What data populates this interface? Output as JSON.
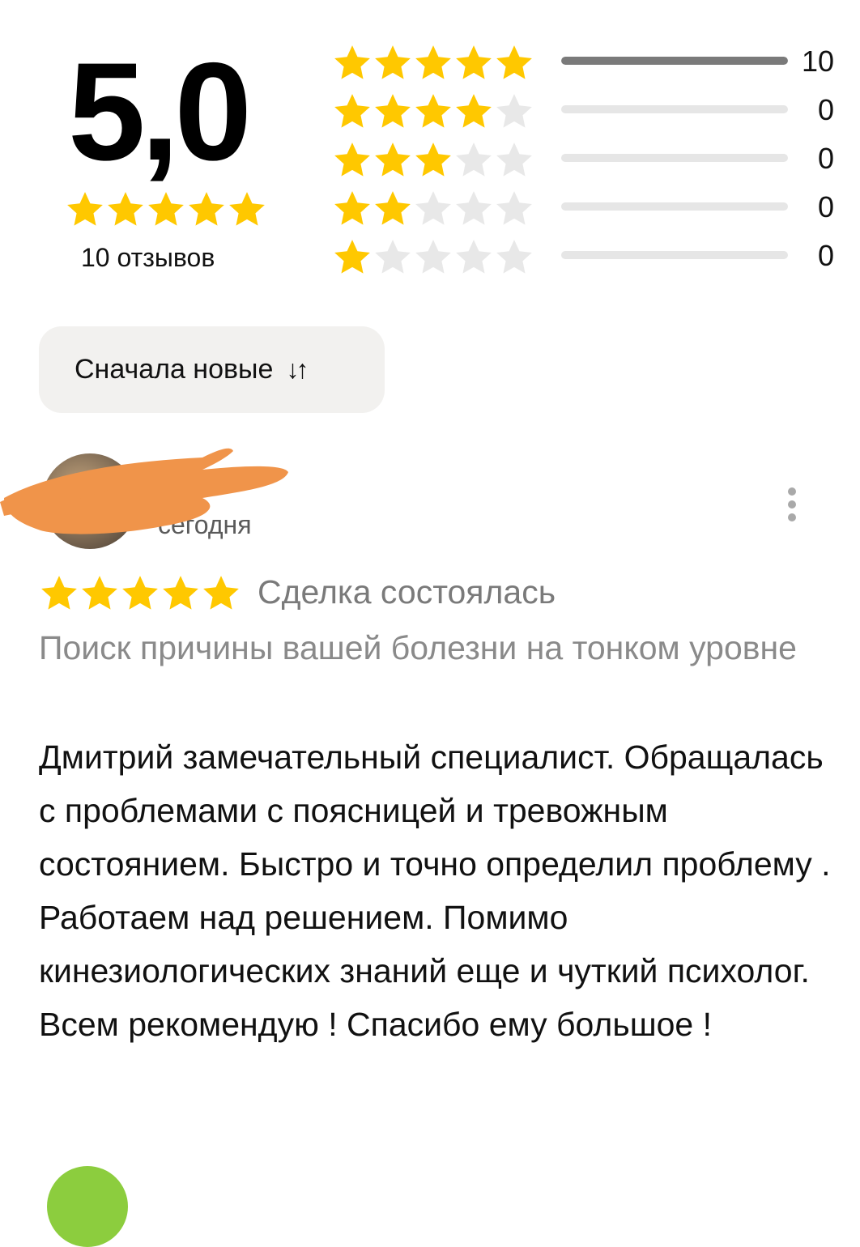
{
  "summary": {
    "average": "5,0",
    "average_stars": 5,
    "total_reviews_label": "10 отзывов"
  },
  "distribution": [
    {
      "stars": 5,
      "count": "10",
      "fraction": 1.0
    },
    {
      "stars": 4,
      "count": "0",
      "fraction": 0
    },
    {
      "stars": 3,
      "count": "0",
      "fraction": 0
    },
    {
      "stars": 2,
      "count": "0",
      "fraction": 0
    },
    {
      "stars": 1,
      "count": "0",
      "fraction": 0
    }
  ],
  "sort": {
    "label": "Сначала новые",
    "icon": "sort-arrows-icon"
  },
  "review": {
    "date": "сегодня",
    "rating": 5,
    "deal_status": "Сделка состоялась",
    "service": "Поиск причины вашей болезни на тонком уровне",
    "text": "Дмитрий замечательный специалист. Обращалась с проблемами с поясницей и тревожным состоянием. Быстро и точно определил проблему . Работаем над решением. Помимо кинезиологических знаний еще и чуткий психолог. Всем рекомендую ! Спасибо ему большое !"
  },
  "colors": {
    "star_filled": "#FFC800",
    "star_empty": "#E8E8E8",
    "bar_filled": "#7A7A7A",
    "bar_empty": "#E6E6E6",
    "redaction": "#F0944A",
    "next_avatar": "#8CCD3E"
  }
}
